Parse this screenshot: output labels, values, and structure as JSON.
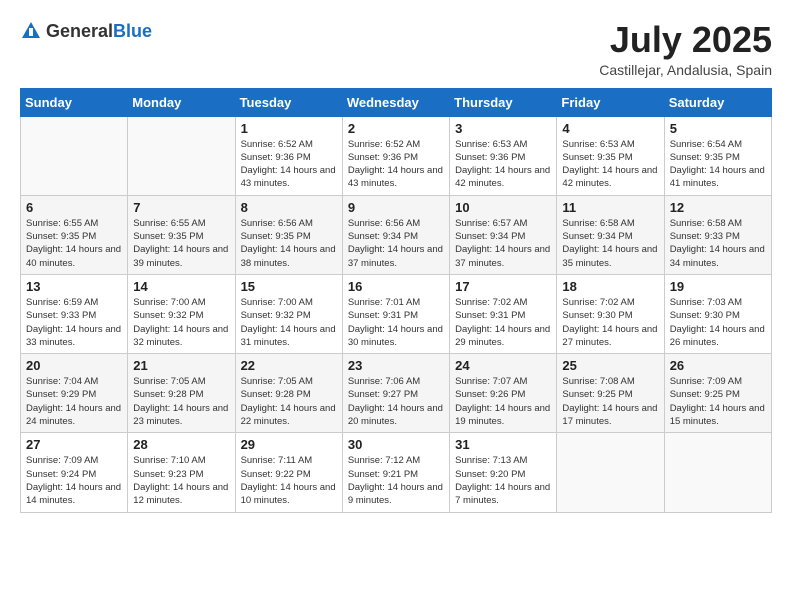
{
  "header": {
    "logo_general": "General",
    "logo_blue": "Blue",
    "month_year": "July 2025",
    "location": "Castillejar, Andalusia, Spain"
  },
  "weekdays": [
    "Sunday",
    "Monday",
    "Tuesday",
    "Wednesday",
    "Thursday",
    "Friday",
    "Saturday"
  ],
  "weeks": [
    [
      {
        "day": "",
        "info": ""
      },
      {
        "day": "",
        "info": ""
      },
      {
        "day": "1",
        "info": "Sunrise: 6:52 AM\nSunset: 9:36 PM\nDaylight: 14 hours and 43 minutes."
      },
      {
        "day": "2",
        "info": "Sunrise: 6:52 AM\nSunset: 9:36 PM\nDaylight: 14 hours and 43 minutes."
      },
      {
        "day": "3",
        "info": "Sunrise: 6:53 AM\nSunset: 9:36 PM\nDaylight: 14 hours and 42 minutes."
      },
      {
        "day": "4",
        "info": "Sunrise: 6:53 AM\nSunset: 9:35 PM\nDaylight: 14 hours and 42 minutes."
      },
      {
        "day": "5",
        "info": "Sunrise: 6:54 AM\nSunset: 9:35 PM\nDaylight: 14 hours and 41 minutes."
      }
    ],
    [
      {
        "day": "6",
        "info": "Sunrise: 6:55 AM\nSunset: 9:35 PM\nDaylight: 14 hours and 40 minutes."
      },
      {
        "day": "7",
        "info": "Sunrise: 6:55 AM\nSunset: 9:35 PM\nDaylight: 14 hours and 39 minutes."
      },
      {
        "day": "8",
        "info": "Sunrise: 6:56 AM\nSunset: 9:35 PM\nDaylight: 14 hours and 38 minutes."
      },
      {
        "day": "9",
        "info": "Sunrise: 6:56 AM\nSunset: 9:34 PM\nDaylight: 14 hours and 37 minutes."
      },
      {
        "day": "10",
        "info": "Sunrise: 6:57 AM\nSunset: 9:34 PM\nDaylight: 14 hours and 37 minutes."
      },
      {
        "day": "11",
        "info": "Sunrise: 6:58 AM\nSunset: 9:34 PM\nDaylight: 14 hours and 35 minutes."
      },
      {
        "day": "12",
        "info": "Sunrise: 6:58 AM\nSunset: 9:33 PM\nDaylight: 14 hours and 34 minutes."
      }
    ],
    [
      {
        "day": "13",
        "info": "Sunrise: 6:59 AM\nSunset: 9:33 PM\nDaylight: 14 hours and 33 minutes."
      },
      {
        "day": "14",
        "info": "Sunrise: 7:00 AM\nSunset: 9:32 PM\nDaylight: 14 hours and 32 minutes."
      },
      {
        "day": "15",
        "info": "Sunrise: 7:00 AM\nSunset: 9:32 PM\nDaylight: 14 hours and 31 minutes."
      },
      {
        "day": "16",
        "info": "Sunrise: 7:01 AM\nSunset: 9:31 PM\nDaylight: 14 hours and 30 minutes."
      },
      {
        "day": "17",
        "info": "Sunrise: 7:02 AM\nSunset: 9:31 PM\nDaylight: 14 hours and 29 minutes."
      },
      {
        "day": "18",
        "info": "Sunrise: 7:02 AM\nSunset: 9:30 PM\nDaylight: 14 hours and 27 minutes."
      },
      {
        "day": "19",
        "info": "Sunrise: 7:03 AM\nSunset: 9:30 PM\nDaylight: 14 hours and 26 minutes."
      }
    ],
    [
      {
        "day": "20",
        "info": "Sunrise: 7:04 AM\nSunset: 9:29 PM\nDaylight: 14 hours and 24 minutes."
      },
      {
        "day": "21",
        "info": "Sunrise: 7:05 AM\nSunset: 9:28 PM\nDaylight: 14 hours and 23 minutes."
      },
      {
        "day": "22",
        "info": "Sunrise: 7:05 AM\nSunset: 9:28 PM\nDaylight: 14 hours and 22 minutes."
      },
      {
        "day": "23",
        "info": "Sunrise: 7:06 AM\nSunset: 9:27 PM\nDaylight: 14 hours and 20 minutes."
      },
      {
        "day": "24",
        "info": "Sunrise: 7:07 AM\nSunset: 9:26 PM\nDaylight: 14 hours and 19 minutes."
      },
      {
        "day": "25",
        "info": "Sunrise: 7:08 AM\nSunset: 9:25 PM\nDaylight: 14 hours and 17 minutes."
      },
      {
        "day": "26",
        "info": "Sunrise: 7:09 AM\nSunset: 9:25 PM\nDaylight: 14 hours and 15 minutes."
      }
    ],
    [
      {
        "day": "27",
        "info": "Sunrise: 7:09 AM\nSunset: 9:24 PM\nDaylight: 14 hours and 14 minutes."
      },
      {
        "day": "28",
        "info": "Sunrise: 7:10 AM\nSunset: 9:23 PM\nDaylight: 14 hours and 12 minutes."
      },
      {
        "day": "29",
        "info": "Sunrise: 7:11 AM\nSunset: 9:22 PM\nDaylight: 14 hours and 10 minutes."
      },
      {
        "day": "30",
        "info": "Sunrise: 7:12 AM\nSunset: 9:21 PM\nDaylight: 14 hours and 9 minutes."
      },
      {
        "day": "31",
        "info": "Sunrise: 7:13 AM\nSunset: 9:20 PM\nDaylight: 14 hours and 7 minutes."
      },
      {
        "day": "",
        "info": ""
      },
      {
        "day": "",
        "info": ""
      }
    ]
  ]
}
